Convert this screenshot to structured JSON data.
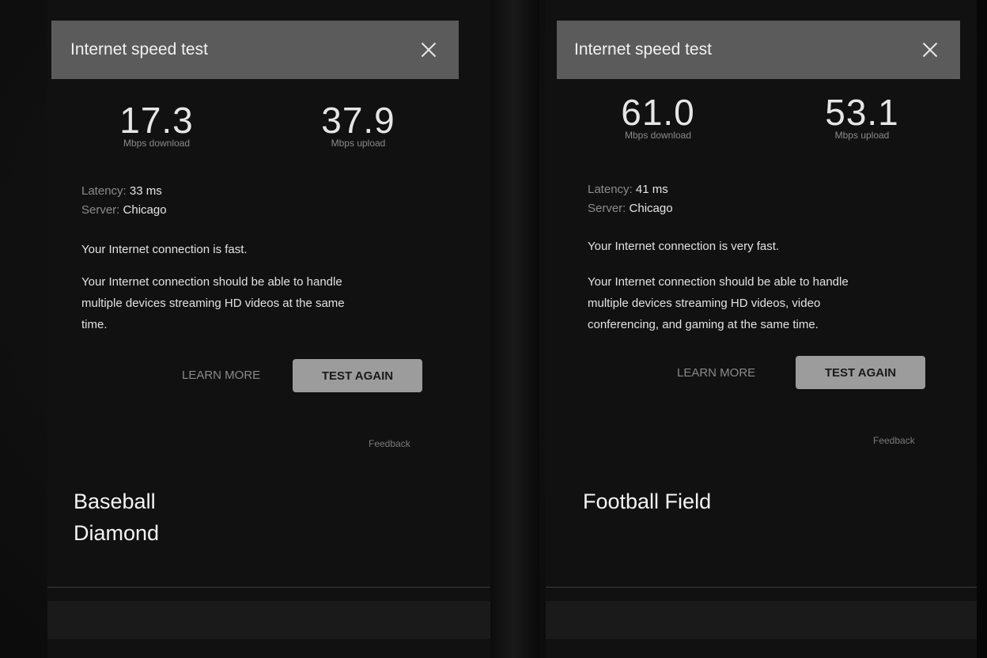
{
  "left": {
    "title": "Internet speed test",
    "download_value": "17.3",
    "download_unit": "Mbps download",
    "upload_value": "37.9",
    "upload_unit": "Mbps upload",
    "latency_label": "Latency:",
    "latency_value": "33 ms",
    "server_label": "Server:",
    "server_value": "Chicago",
    "summary": "Your Internet connection is fast.",
    "detail_line1": "Your Internet connection should be able to handle",
    "detail_line2": "multiple devices streaming HD videos at the same",
    "detail_line3": "time.",
    "learn_more": "LEARN MORE",
    "test_again": "TEST AGAIN",
    "feedback": "Feedback",
    "caption_line1": "Baseball",
    "caption_line2": "Diamond"
  },
  "right": {
    "title": "Internet speed test",
    "download_value": "61.0",
    "download_unit": "Mbps download",
    "upload_value": "53.1",
    "upload_unit": "Mbps upload",
    "latency_label": "Latency:",
    "latency_value": "41 ms",
    "server_label": "Server:",
    "server_value": "Chicago",
    "summary": "Your Internet connection is very fast.",
    "detail_line1": "Your Internet connection should be able to handle",
    "detail_line2": "multiple devices streaming HD videos, video",
    "detail_line3": "conferencing, and gaming at the same time.",
    "learn_more": "LEARN MORE",
    "test_again": "TEST AGAIN",
    "feedback": "Feedback",
    "caption_line1": "Football Field"
  },
  "icons": {
    "close": "close-icon"
  }
}
